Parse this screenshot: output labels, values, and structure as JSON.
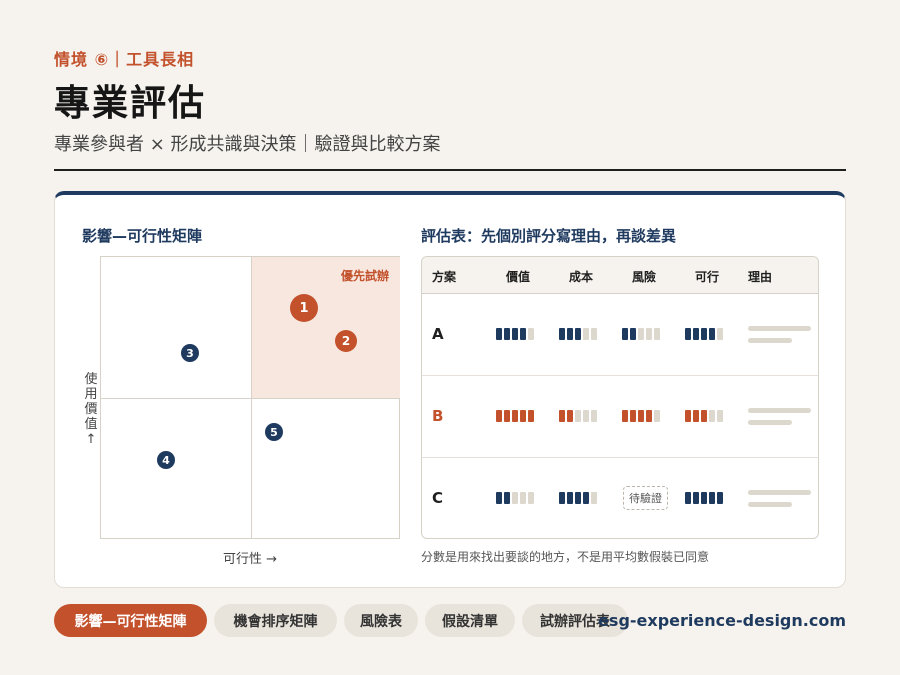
{
  "header": {
    "kicker": "情境 ⑥｜工具長相",
    "title": "專業評估",
    "subtitle": "專業參與者 × 形成共識與決策｜驗證與比較方案"
  },
  "matrix": {
    "title": "影響—可行性矩陣",
    "priority_label": "優先試辦",
    "y_label": "使用價值↑",
    "x_label": "可行性 →",
    "points": [
      {
        "label": "1",
        "group": "priority"
      },
      {
        "label": "2",
        "group": "priority"
      },
      {
        "label": "3",
        "group": "other"
      },
      {
        "label": "4",
        "group": "other"
      },
      {
        "label": "5",
        "group": "other"
      }
    ]
  },
  "table": {
    "title": "評估表：先個別評分寫理由，再談差異",
    "columns": [
      "方案",
      "價值",
      "成本",
      "風險",
      "可行",
      "理由"
    ],
    "scale_max": 5,
    "rows": [
      {
        "name": "A",
        "value": 4,
        "cost": 3,
        "risk": 2,
        "feasible": 4,
        "highlight": false
      },
      {
        "name": "B",
        "value": 5,
        "cost": 2,
        "risk": 4,
        "feasible": 3,
        "highlight": true
      },
      {
        "name": "C",
        "value": 2,
        "cost": 4,
        "risk": null,
        "feasible": 5,
        "highlight": false
      }
    ],
    "pending_label": "待驗證",
    "note": "分數是用來找出要談的地方，不是用平均數假裝已同意"
  },
  "colors": {
    "navy": "#1f3a5f",
    "accent": "#c2512c",
    "empty": "#dcd8cd"
  },
  "nav": {
    "items": [
      "影響—可行性矩陣",
      "機會排序矩陣",
      "風險表",
      "假設清單",
      "試辦評估表"
    ],
    "active_index": 0
  },
  "site": "esg-experience-design.com"
}
